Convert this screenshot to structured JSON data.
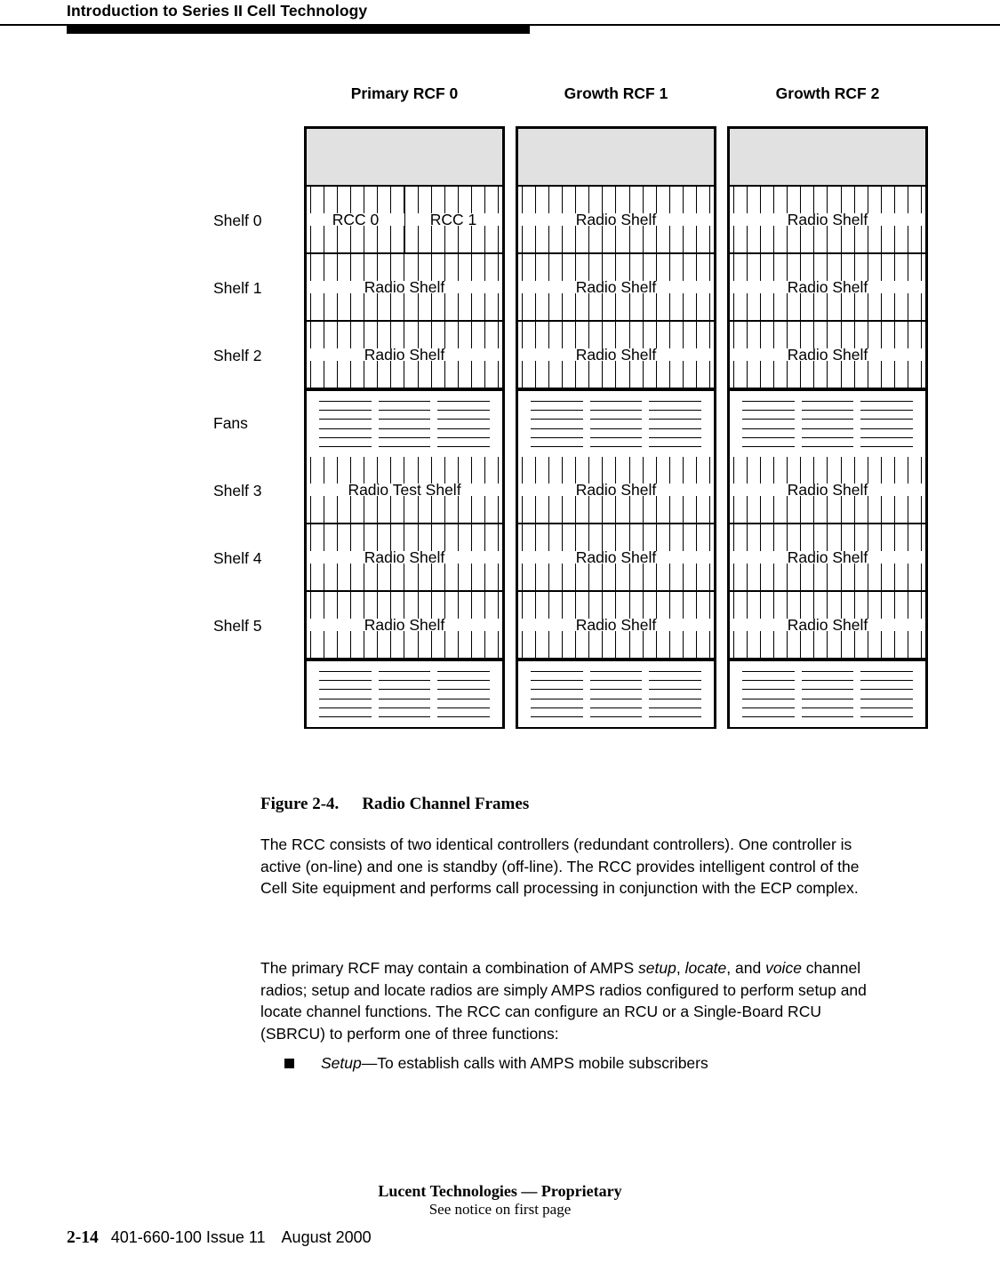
{
  "header": {
    "title": "Introduction to Series II Cell Technology"
  },
  "figure": {
    "columns": [
      {
        "title": "Primary RCF 0"
      },
      {
        "title": "Growth RCF 1"
      },
      {
        "title": "Growth RCF 2"
      }
    ],
    "row_labels": [
      "Shelf 0",
      "Shelf 1",
      "Shelf 2",
      "Fans",
      "Shelf 3",
      "Shelf 4",
      "Shelf 5"
    ],
    "rows": [
      {
        "label": "Shelf 0",
        "cells": [
          {
            "type": "split",
            "labels": [
              "RCC 0",
              "RCC 1"
            ]
          },
          {
            "type": "shelf",
            "label": "Radio Shelf"
          },
          {
            "type": "shelf",
            "label": "Radio Shelf"
          }
        ]
      },
      {
        "label": "Shelf 1",
        "cells": [
          {
            "type": "shelf",
            "label": "Radio Shelf"
          },
          {
            "type": "shelf",
            "label": "Radio Shelf"
          },
          {
            "type": "shelf",
            "label": "Radio Shelf"
          }
        ]
      },
      {
        "label": "Shelf 2",
        "cells": [
          {
            "type": "shelf",
            "label": "Radio Shelf"
          },
          {
            "type": "shelf",
            "label": "Radio Shelf"
          },
          {
            "type": "shelf",
            "label": "Radio Shelf"
          }
        ]
      },
      {
        "label": "Fans",
        "cells": [
          {
            "type": "fans",
            "label": ""
          },
          {
            "type": "fans",
            "label": ""
          },
          {
            "type": "fans",
            "label": ""
          }
        ]
      },
      {
        "label": "Shelf 3",
        "cells": [
          {
            "type": "shelf",
            "label": "Radio Test Shelf"
          },
          {
            "type": "shelf",
            "label": "Radio Shelf"
          },
          {
            "type": "shelf",
            "label": "Radio Shelf"
          }
        ]
      },
      {
        "label": "Shelf 4",
        "cells": [
          {
            "type": "shelf",
            "label": "Radio Shelf"
          },
          {
            "type": "shelf",
            "label": "Radio Shelf"
          },
          {
            "type": "shelf",
            "label": "Radio Shelf"
          }
        ]
      },
      {
        "label": "Shelf 5",
        "cells": [
          {
            "type": "shelf",
            "label": "Radio Shelf"
          },
          {
            "type": "shelf",
            "label": "Radio Shelf"
          },
          {
            "type": "shelf",
            "label": "Radio Shelf"
          }
        ]
      },
      {
        "label": "",
        "cells": [
          {
            "type": "fans",
            "label": ""
          },
          {
            "type": "fans",
            "label": ""
          },
          {
            "type": "fans",
            "label": ""
          }
        ]
      }
    ]
  },
  "caption": {
    "number": "Figure 2-4.",
    "text": "Radio Channel Frames"
  },
  "body": {
    "paragraph_1": "The RCC consists of two identical controllers (redundant controllers). One controller is active (on-line) and one is standby (off-line). The RCC provides intelligent control of the Cell Site equipment and performs call processing in conjunction with the ECP complex.",
    "paragraph_2_parts": [
      {
        "text": "The primary RCF may contain a combination of AMPS ",
        "italic": false
      },
      {
        "text": "setup",
        "italic": true
      },
      {
        "text": ", ",
        "italic": false
      },
      {
        "text": "locate",
        "italic": true
      },
      {
        "text": ", and ",
        "italic": false
      },
      {
        "text": "voice",
        "italic": true
      },
      {
        "text": " channel radios; setup and locate radios are simply AMPS radios configured to perform setup and locate channel functions. The RCC can configure an RCU or a Single-Board RCU (SBRCU) to perform one of three functions:",
        "italic": false
      }
    ],
    "bullets": [
      {
        "parts": [
          {
            "text": "Setup",
            "italic": true
          },
          {
            "text": "—To establish calls with AMPS mobile subscribers",
            "italic": false
          }
        ]
      }
    ]
  },
  "footer": {
    "notice_line_1": "Lucent Technologies — Proprietary",
    "notice_line_2": "See notice on first page",
    "page_number": "2-14",
    "document_number": "401-660-100 Issue 11",
    "date": "August 2000"
  }
}
